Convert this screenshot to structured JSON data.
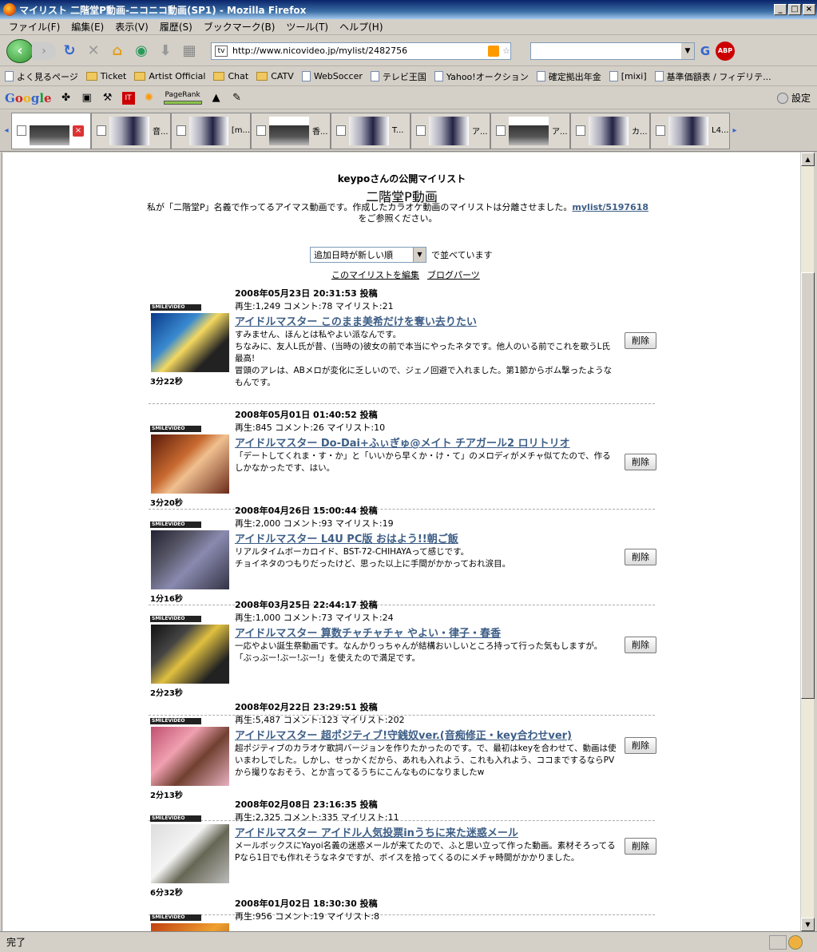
{
  "window": {
    "title": "マイリスト 二階堂P動画‐ニコニコ動画(SP1) - Mozilla Firefox"
  },
  "menu": [
    "ファイル(F)",
    "編集(E)",
    "表示(V)",
    "履歴(S)",
    "ブックマーク(B)",
    "ツール(T)",
    "ヘルプ(H)"
  ],
  "nav": {
    "url": "http://www.nicovideo.jp/mylist/2482756"
  },
  "bookmarks": [
    "よく見るページ",
    "Ticket",
    "Artist Official",
    "Chat",
    "CATV",
    "WebSoccer",
    "テレビ王国",
    "Yahoo!オークション",
    "確定拠出年金",
    "[mixi]",
    "基準価額表 / フィデリテ..."
  ],
  "google_toolbar": {
    "logo": "Google",
    "pagerank": "PageRank",
    "settings": "設定"
  },
  "tabs": [
    "",
    "音...",
    "[m...",
    "香...",
    "T...",
    "ア...",
    "ア...",
    "カ...",
    "L4..."
  ],
  "page": {
    "owner": "keypoさんの公開マイリスト",
    "title": "二階堂P動画",
    "desc1": "私が「二階堂P」名義で作ってるアイマス動画です。作成したカラオケ動画のマイリストは分離させました。",
    "desc_link": "mylist/5197618",
    "desc2": "をご参照ください。",
    "sort_value": "追加日時が新しい順",
    "sort_suffix": "で並べています",
    "edit_link": "このマイリストを編集",
    "blog_link": "ブログパーツ",
    "badge": "SMILEVIDEO",
    "delete": "削除"
  },
  "items": [
    {
      "date": "2008年05月23日  20:31:53 投稿",
      "stats": "再生:1,249  コメント:78  マイリスト:21",
      "title": "アイドルマスター このまま美希だけを奪い去りたい",
      "desc": "すみません、ほんとは私やよい派なんです。\nちなみに、友人L氏が昔、(当時の)彼女の前で本当にやったネタです。他人のいる前でこれを歌うL氏最高!\n冒頭のアレは、ABメロが変化に乏しいので、ジェノ回避で入れました。第1節からボム撃ったようなもんです。",
      "length": "3分22秒"
    },
    {
      "date": "2008年05月01日  01:40:52 投稿",
      "stats": "再生:845  コメント:26  マイリスト:10",
      "title": "アイドルマスター Do-Dai+ふぃぎゅ@メイト チアガール2 ロリトリオ",
      "desc": "「デートしてくれま・す・か」と「いいから早くか・け・て」のメロディがメチャ似てたので、作るしかなかったです、はい。",
      "length": "3分20秒"
    },
    {
      "date": "2008年04月26日  15:00:44 投稿",
      "stats": "再生:2,000  コメント:93  マイリスト:19",
      "title": "アイドルマスター L4U PC版 おはよう!!朝ご飯",
      "desc": "リアルタイムボーカロイド、BST-72-CHIHAYAって感じです。\nチョイネタのつもりだったけど、思った以上に手間がかかっておれ涙目。",
      "length": "1分16秒"
    },
    {
      "date": "2008年03月25日  22:44:17 投稿",
      "stats": "再生:1,000  コメント:73  マイリスト:24",
      "title": "アイドルマスター 算数チャチャチャ やよい・律子・春香",
      "desc": "一応やよい誕生祭動画です。なんかりっちゃんが結構おいしいところ持って行った気もしますが。\n「ぶっぶー!ぶー!ぶー!」を使えたので満足です。",
      "length": "2分23秒"
    },
    {
      "date": "2008年02月22日  23:29:51 投稿",
      "stats": "再生:5,487  コメント:123  マイリスト:202",
      "title": "アイドルマスター 超ポジティブ!守銭奴ver.(音痴修正・key合わせver)",
      "desc": "超ポジティブのカラオケ歌詞バージョンを作りたかったのです。で、最初はkeyを合わせて、動画は使いまわしでした。しかし、せっかくだから、あれも入れよう、これも入れよう、ココまでするならPVから撮りなおそう、とか言ってるうちにこんなものになりましたw",
      "length": "2分13秒"
    },
    {
      "date": "2008年02月08日  23:16:35 投稿",
      "stats": "再生:2,325  コメント:335  マイリスト:11",
      "title": "アイドルマスター アイドル人気投票inうちに来た迷惑メール",
      "desc": "メールボックスにYayoi名義の迷惑メールが来てたので、ふと思い立って作った動画。素材そろってるPなら1日でも作れそうなネタですが、ボイスを拾ってくるのにメチャ時間がかかりました。",
      "length": "6分32秒"
    },
    {
      "date": "2008年01月02日  18:30:30 投稿",
      "stats": "再生:956  コメント:19  マイリスト:8",
      "title": "",
      "desc": "",
      "length": ""
    }
  ],
  "status": "完了"
}
